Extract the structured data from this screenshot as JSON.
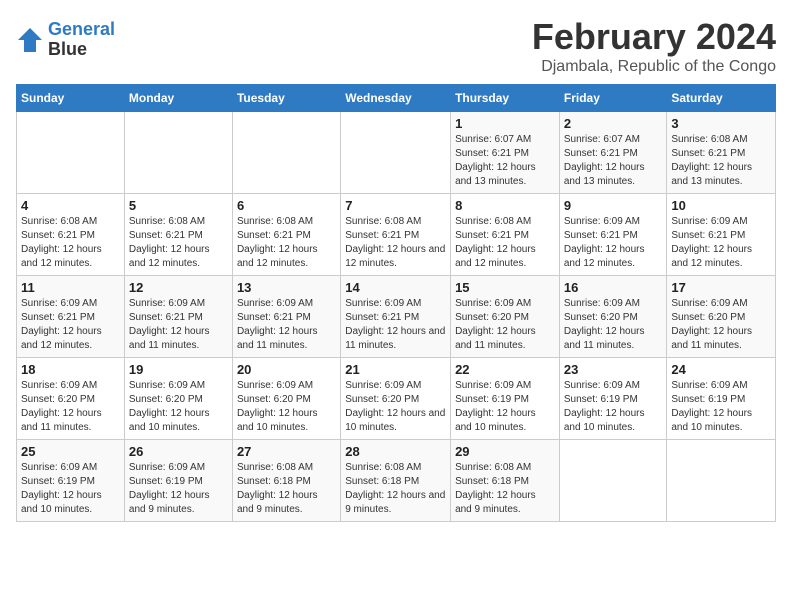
{
  "header": {
    "logo_line1": "General",
    "logo_line2": "Blue",
    "title": "February 2024",
    "subtitle": "Djambala, Republic of the Congo"
  },
  "weekdays": [
    "Sunday",
    "Monday",
    "Tuesday",
    "Wednesday",
    "Thursday",
    "Friday",
    "Saturday"
  ],
  "weeks": [
    [
      {
        "day": "",
        "info": ""
      },
      {
        "day": "",
        "info": ""
      },
      {
        "day": "",
        "info": ""
      },
      {
        "day": "",
        "info": ""
      },
      {
        "day": "1",
        "info": "Sunrise: 6:07 AM\nSunset: 6:21 PM\nDaylight: 12 hours and 13 minutes."
      },
      {
        "day": "2",
        "info": "Sunrise: 6:07 AM\nSunset: 6:21 PM\nDaylight: 12 hours and 13 minutes."
      },
      {
        "day": "3",
        "info": "Sunrise: 6:08 AM\nSunset: 6:21 PM\nDaylight: 12 hours and 13 minutes."
      }
    ],
    [
      {
        "day": "4",
        "info": "Sunrise: 6:08 AM\nSunset: 6:21 PM\nDaylight: 12 hours and 12 minutes."
      },
      {
        "day": "5",
        "info": "Sunrise: 6:08 AM\nSunset: 6:21 PM\nDaylight: 12 hours and 12 minutes."
      },
      {
        "day": "6",
        "info": "Sunrise: 6:08 AM\nSunset: 6:21 PM\nDaylight: 12 hours and 12 minutes."
      },
      {
        "day": "7",
        "info": "Sunrise: 6:08 AM\nSunset: 6:21 PM\nDaylight: 12 hours and 12 minutes."
      },
      {
        "day": "8",
        "info": "Sunrise: 6:08 AM\nSunset: 6:21 PM\nDaylight: 12 hours and 12 minutes."
      },
      {
        "day": "9",
        "info": "Sunrise: 6:09 AM\nSunset: 6:21 PM\nDaylight: 12 hours and 12 minutes."
      },
      {
        "day": "10",
        "info": "Sunrise: 6:09 AM\nSunset: 6:21 PM\nDaylight: 12 hours and 12 minutes."
      }
    ],
    [
      {
        "day": "11",
        "info": "Sunrise: 6:09 AM\nSunset: 6:21 PM\nDaylight: 12 hours and 12 minutes."
      },
      {
        "day": "12",
        "info": "Sunrise: 6:09 AM\nSunset: 6:21 PM\nDaylight: 12 hours and 11 minutes."
      },
      {
        "day": "13",
        "info": "Sunrise: 6:09 AM\nSunset: 6:21 PM\nDaylight: 12 hours and 11 minutes."
      },
      {
        "day": "14",
        "info": "Sunrise: 6:09 AM\nSunset: 6:21 PM\nDaylight: 12 hours and 11 minutes."
      },
      {
        "day": "15",
        "info": "Sunrise: 6:09 AM\nSunset: 6:20 PM\nDaylight: 12 hours and 11 minutes."
      },
      {
        "day": "16",
        "info": "Sunrise: 6:09 AM\nSunset: 6:20 PM\nDaylight: 12 hours and 11 minutes."
      },
      {
        "day": "17",
        "info": "Sunrise: 6:09 AM\nSunset: 6:20 PM\nDaylight: 12 hours and 11 minutes."
      }
    ],
    [
      {
        "day": "18",
        "info": "Sunrise: 6:09 AM\nSunset: 6:20 PM\nDaylight: 12 hours and 11 minutes."
      },
      {
        "day": "19",
        "info": "Sunrise: 6:09 AM\nSunset: 6:20 PM\nDaylight: 12 hours and 10 minutes."
      },
      {
        "day": "20",
        "info": "Sunrise: 6:09 AM\nSunset: 6:20 PM\nDaylight: 12 hours and 10 minutes."
      },
      {
        "day": "21",
        "info": "Sunrise: 6:09 AM\nSunset: 6:20 PM\nDaylight: 12 hours and 10 minutes."
      },
      {
        "day": "22",
        "info": "Sunrise: 6:09 AM\nSunset: 6:19 PM\nDaylight: 12 hours and 10 minutes."
      },
      {
        "day": "23",
        "info": "Sunrise: 6:09 AM\nSunset: 6:19 PM\nDaylight: 12 hours and 10 minutes."
      },
      {
        "day": "24",
        "info": "Sunrise: 6:09 AM\nSunset: 6:19 PM\nDaylight: 12 hours and 10 minutes."
      }
    ],
    [
      {
        "day": "25",
        "info": "Sunrise: 6:09 AM\nSunset: 6:19 PM\nDaylight: 12 hours and 10 minutes."
      },
      {
        "day": "26",
        "info": "Sunrise: 6:09 AM\nSunset: 6:19 PM\nDaylight: 12 hours and 9 minutes."
      },
      {
        "day": "27",
        "info": "Sunrise: 6:08 AM\nSunset: 6:18 PM\nDaylight: 12 hours and 9 minutes."
      },
      {
        "day": "28",
        "info": "Sunrise: 6:08 AM\nSunset: 6:18 PM\nDaylight: 12 hours and 9 minutes."
      },
      {
        "day": "29",
        "info": "Sunrise: 6:08 AM\nSunset: 6:18 PM\nDaylight: 12 hours and 9 minutes."
      },
      {
        "day": "",
        "info": ""
      },
      {
        "day": "",
        "info": ""
      }
    ]
  ]
}
